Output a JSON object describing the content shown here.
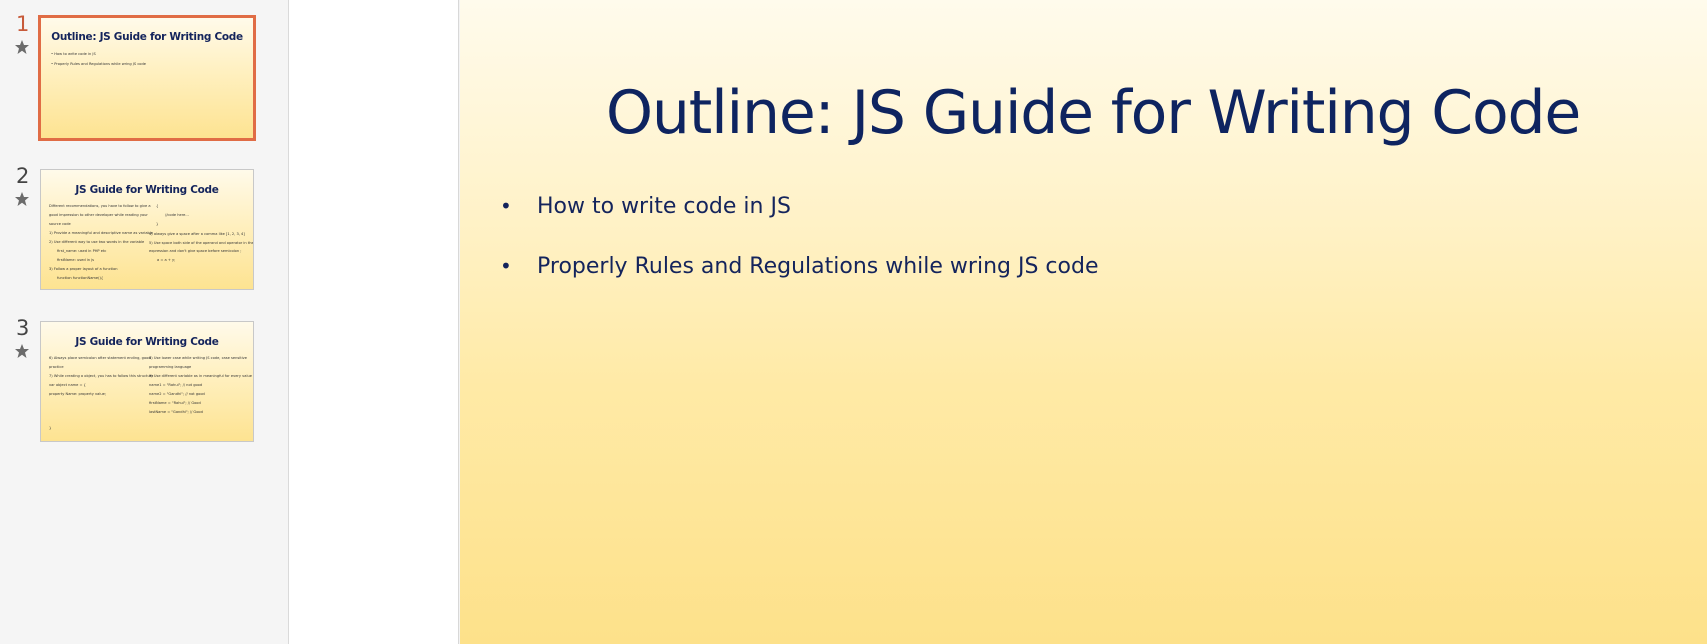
{
  "thumbnails": [
    {
      "number": "1",
      "title": "Outline: JS Guide for Writing Code",
      "lines": [
        "How to write code in JS",
        "Properly Rules and Regulations while wring JS code"
      ]
    },
    {
      "number": "2",
      "title": "JS Guide for Writing Code",
      "left_lines": [
        "Different recommendations, you have to follow to give a",
        "good impression to other developer while reading your",
        "source code",
        "1) Provide a meaningful and descriptive name as variable",
        "2) Use different way to use two words in the variable",
        "first_name: used in PHP etc",
        "firstName: used in js",
        "3) Follow a proper layout of a function",
        "function functionName(){"
      ],
      "right_lines": [
        "{",
        "//code here...",
        "}",
        "4) always give a space after a comma like [1, 2, 3, 4]",
        "5) Use space both side of the operand and operator in the",
        "expression and don't give space before semicolon ;",
        "a = a + y;"
      ]
    },
    {
      "number": "3",
      "title": "JS Guide for Writing Code",
      "left_lines": [
        "6) Always place semicolon after statement ending, good",
        "practice",
        "7) While creating a object, you has to follow this structure",
        "var object name = {",
        "property Name: property value;",
        "}"
      ],
      "right_lines": [
        "8) Use lower case while writing JS code, case sensitive",
        "programming language",
        "9) Use different variable as in meaningful for every value",
        "name1 = \"Rahul\"; // not good",
        "name2 = \"Gandhi\"; // not good",
        "firstName = \"Rahul\"; // Good",
        "lastName = \"Gandhi\"; // Good"
      ]
    }
  ],
  "slide": {
    "title": "Outline: JS Guide for Writing Code",
    "bullets": [
      "How to write code in JS",
      "Properly Rules and Regulations while wring JS code"
    ]
  },
  "colors": {
    "title": "#0e2460",
    "active_border": "#e06c45",
    "gradient_top": "#fffbec",
    "gradient_bottom": "#fde18a"
  },
  "icons": [
    "star-icon"
  ]
}
